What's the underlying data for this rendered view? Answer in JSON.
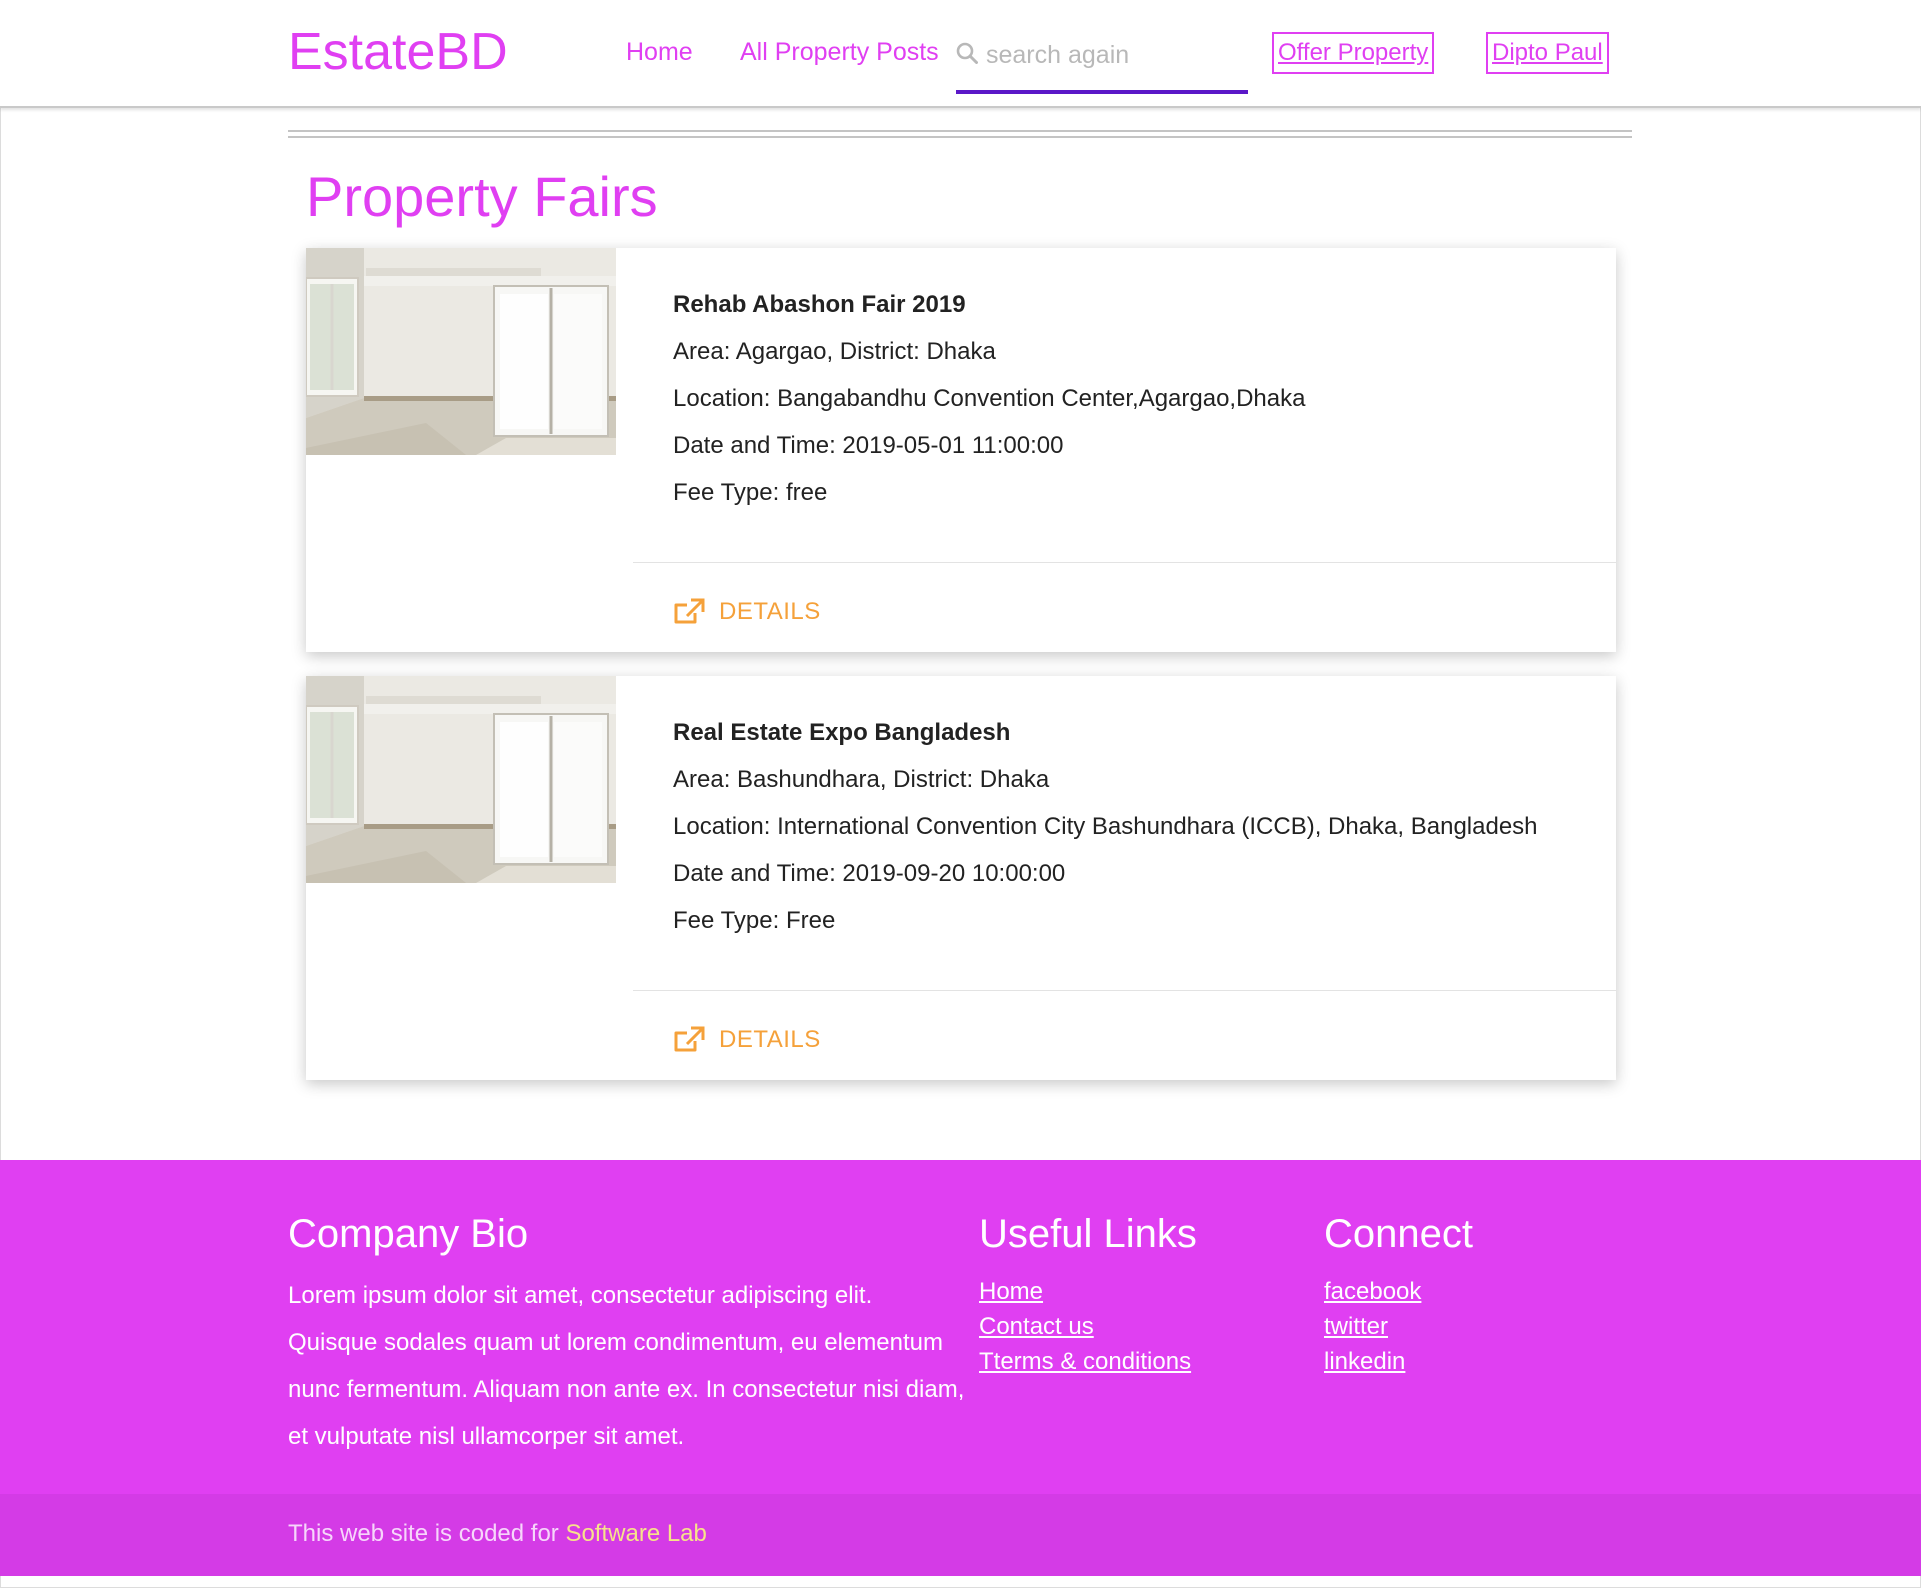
{
  "navbar": {
    "brand": "EstateBD",
    "links": [
      {
        "label": "Home"
      },
      {
        "label": "All Property Posts"
      }
    ],
    "search": {
      "placeholder": "search again",
      "value": ""
    },
    "offer_button": "Offer Property",
    "user_button": "Dipto Paul"
  },
  "main": {
    "title": "Property Fairs",
    "cards": [
      {
        "title": "Rehab Abashon Fair 2019",
        "area": "Area: Agargao, District: Dhaka",
        "location": "Location: Bangabandhu Convention Center,Agargao,Dhaka",
        "datetime": "Date and Time: 2019-05-01 11:00:00",
        "fee": "Fee Type: free",
        "details_label": "DETAILS"
      },
      {
        "title": "Real Estate Expo Bangladesh",
        "area": "Area: Bashundhara, District: Dhaka",
        "location": "Location: International Convention City Bashundhara (ICCB), Dhaka, Bangladesh",
        "datetime": "Date and Time: 2019-09-20 10:00:00",
        "fee": "Fee Type: Free",
        "details_label": "DETAILS"
      }
    ]
  },
  "footer": {
    "bio_heading": "Company Bio",
    "bio_text": "Lorem ipsum dolor sit amet, consectetur adipiscing elit. Quisque sodales quam ut lorem condimentum, eu elementum nunc fermentum. Aliquam non ante ex. In consectetur nisi diam, et vulputate nisl ullamcorper sit amet.",
    "links_heading": "Useful Links",
    "links": [
      "Home",
      "Contact us",
      "Tterms & conditions"
    ],
    "connect_heading": "Connect",
    "connect": [
      "facebook",
      "twitter",
      "linkedin"
    ]
  },
  "subfooter": {
    "text": "This web site is coded for ",
    "link": "Software Lab"
  },
  "colors": {
    "brand": "#e03ff2",
    "accent_orange": "#f5a13a",
    "search_underline": "#5b18c8",
    "footer_bg": "#e03ff2",
    "subfooter_bg": "#d43be6"
  },
  "icons": {
    "search": "search-icon",
    "details": "external-link-icon",
    "card_image": "empty-room-photo"
  }
}
